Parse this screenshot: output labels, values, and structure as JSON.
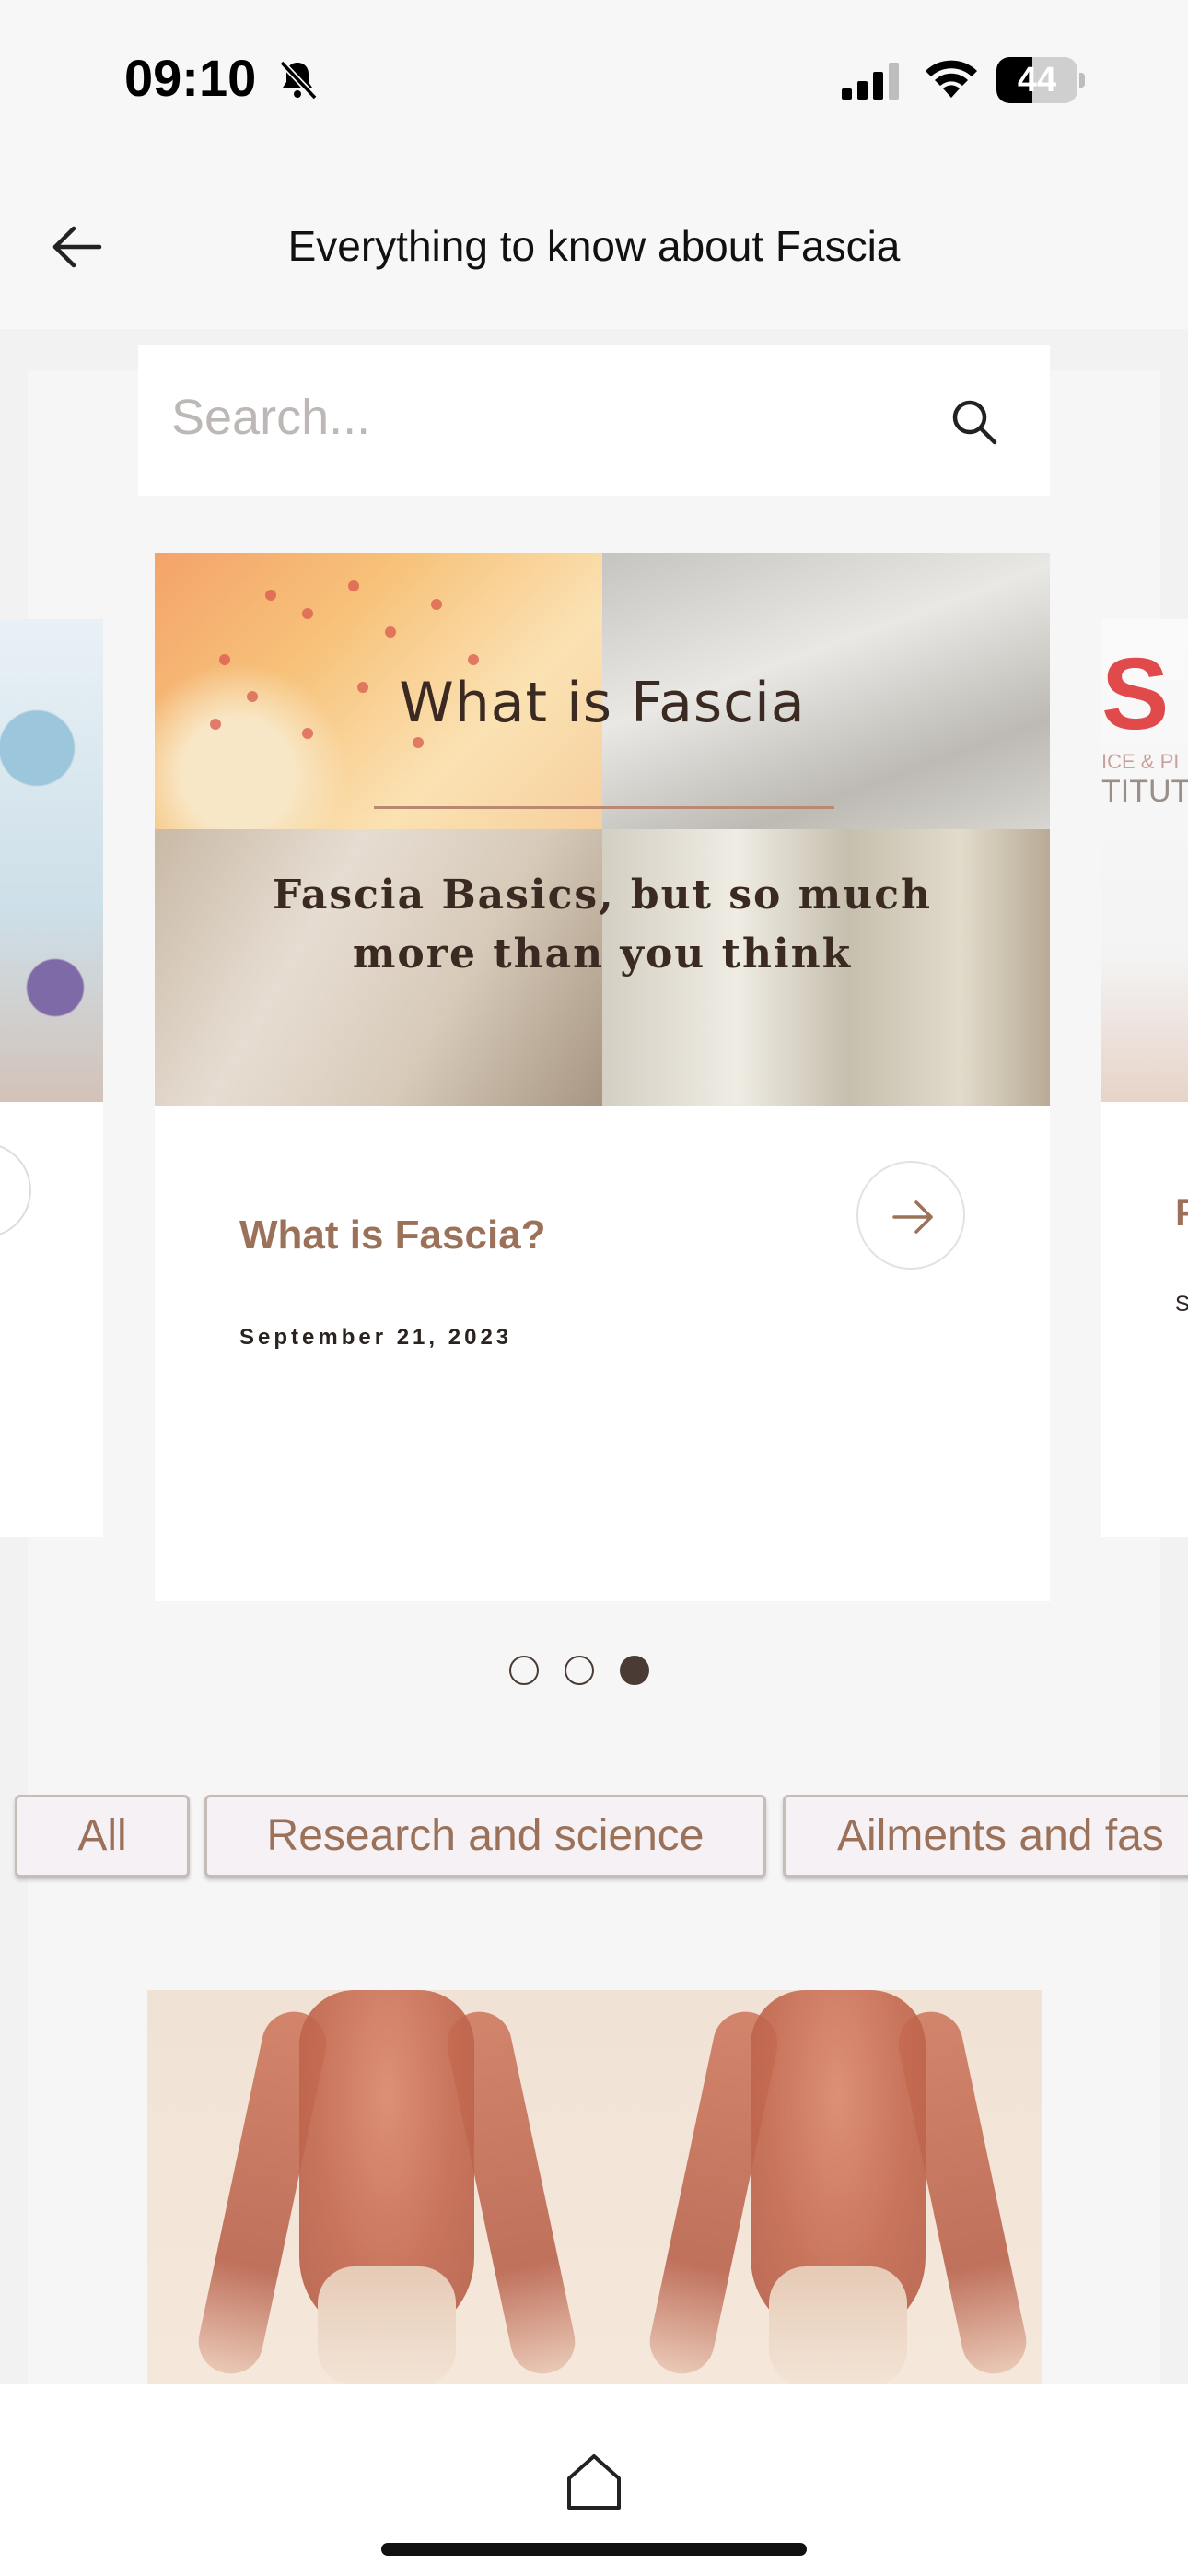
{
  "status_bar": {
    "time": "09:10",
    "battery": "44",
    "battery_level": 0.44,
    "icons": [
      "bell-slash-icon",
      "cellular-signal-icon",
      "wifi-icon",
      "battery-icon"
    ]
  },
  "header": {
    "title": "Everything to know about Fascia",
    "back_icon": "arrow-left-icon"
  },
  "search": {
    "placeholder": "Search...",
    "icon": "search-icon"
  },
  "carousel": {
    "current_index": 2,
    "page_count": 3,
    "active_card": {
      "hero_title": "What is Fascia",
      "hero_subtitle": "Fascia Basics, but so much more than you think",
      "post_title": "What is Fascia?",
      "date": "September 21, 2023",
      "action_icon": "arrow-right-icon"
    },
    "right_peek": {
      "logo_text": "S",
      "tag_line_1": "ICE & PI",
      "tag_line_2": "TITUT",
      "title_initial": "F",
      "date_initial": "S"
    }
  },
  "categories": [
    {
      "label": "All"
    },
    {
      "label": "Research and science"
    },
    {
      "label": "Ailments and fas"
    }
  ],
  "bottom_nav": {
    "home_icon": "home-icon"
  },
  "colors": {
    "accent_brown": "#9b7259",
    "dark_brown": "#4a3c34",
    "chip_bg": "#f6f1f4"
  }
}
